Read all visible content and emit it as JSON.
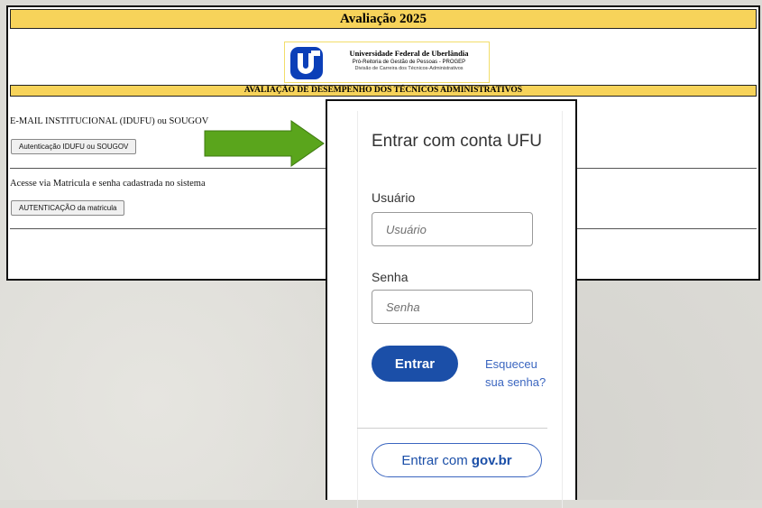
{
  "old_page": {
    "title": "Avaliação 2025",
    "logo": {
      "university": "Universidade Federal de Uberlândia",
      "line1": "Pró-Reitoria de Gestão de Pessoas - PROGEP",
      "line2": "Divisão de Carreira dos Técnicos-Administrativos"
    },
    "section_title": "AVALIAÇÃO DE DESEMPENHO DOS TÉCNICOS ADMINISTRATIVOS",
    "email_label": "E-MAIL INSTITUCIONAL (IDUFU) ou SOUGOV",
    "email_button": "Autenticação IDUFU ou SOUGOV",
    "matricula_label": "Acesse via Matricula e senha cadastrada no sistema",
    "matricula_button": "AUTENTICAÇÃO da matricula"
  },
  "login": {
    "title": "Entrar com conta UFU",
    "user_label": "Usuário",
    "user_placeholder": "Usuário",
    "password_label": "Senha",
    "password_placeholder": "Senha",
    "submit_label": "Entrar",
    "forgot_label": "Esqueceu sua senha?",
    "govbr_prefix": "Entrar com ",
    "govbr_brand": "gov.br"
  },
  "colors": {
    "title_bar": "#f7d35a",
    "arrow": "#5aa51c",
    "primary_button": "#1b4fa8",
    "link": "#3b66c0",
    "ufu_logo": "#0b3fb8"
  }
}
